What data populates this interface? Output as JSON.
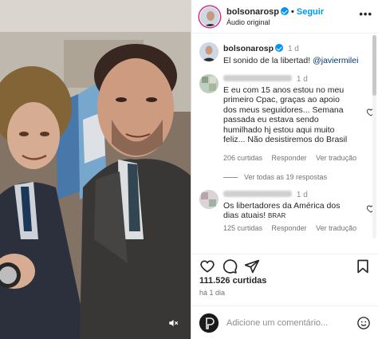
{
  "post": {
    "username": "bolsonarosp",
    "follow_label": "Seguir",
    "audio": "Áudio original",
    "more_label": "•••"
  },
  "caption": {
    "username": "bolsonarosp",
    "time": "1 d",
    "text": "El sonido de la libertad! ",
    "mention": "@javiermilei"
  },
  "comments": [
    {
      "time": "1 d",
      "text": "E eu com 15 anos estou no meu primeiro Cpac, graças ao apoio dos meus seguidores... Semana passada eu estava sendo humilhado hj estou aqui muito feliz... Não desistiremos do Brasil",
      "likes": "206 curtidas",
      "reply": "Responder",
      "translate": "Ver tradução"
    },
    {
      "time": "1 d",
      "text": "Os libertadores da América dos dias atuais! ",
      "flag": "BRAR",
      "likes": "125 curtidas",
      "reply": "Responder",
      "translate": "Ver tradução"
    }
  ],
  "replies_label": "Ver todas as 19 respostas",
  "likes_total": "111.526 curtidas",
  "posted_ago": "há 1 dia",
  "comment_input": {
    "placeholder": "Adicione um comentário..."
  },
  "icons": [
    "heart-icon",
    "comment-icon",
    "share-icon",
    "bookmark-icon",
    "smile-icon",
    "mute-icon",
    "verified-badge-icon"
  ],
  "colors": {
    "accent": "#0095f6",
    "verified": "#0095f6",
    "muted_text": "#737373"
  }
}
